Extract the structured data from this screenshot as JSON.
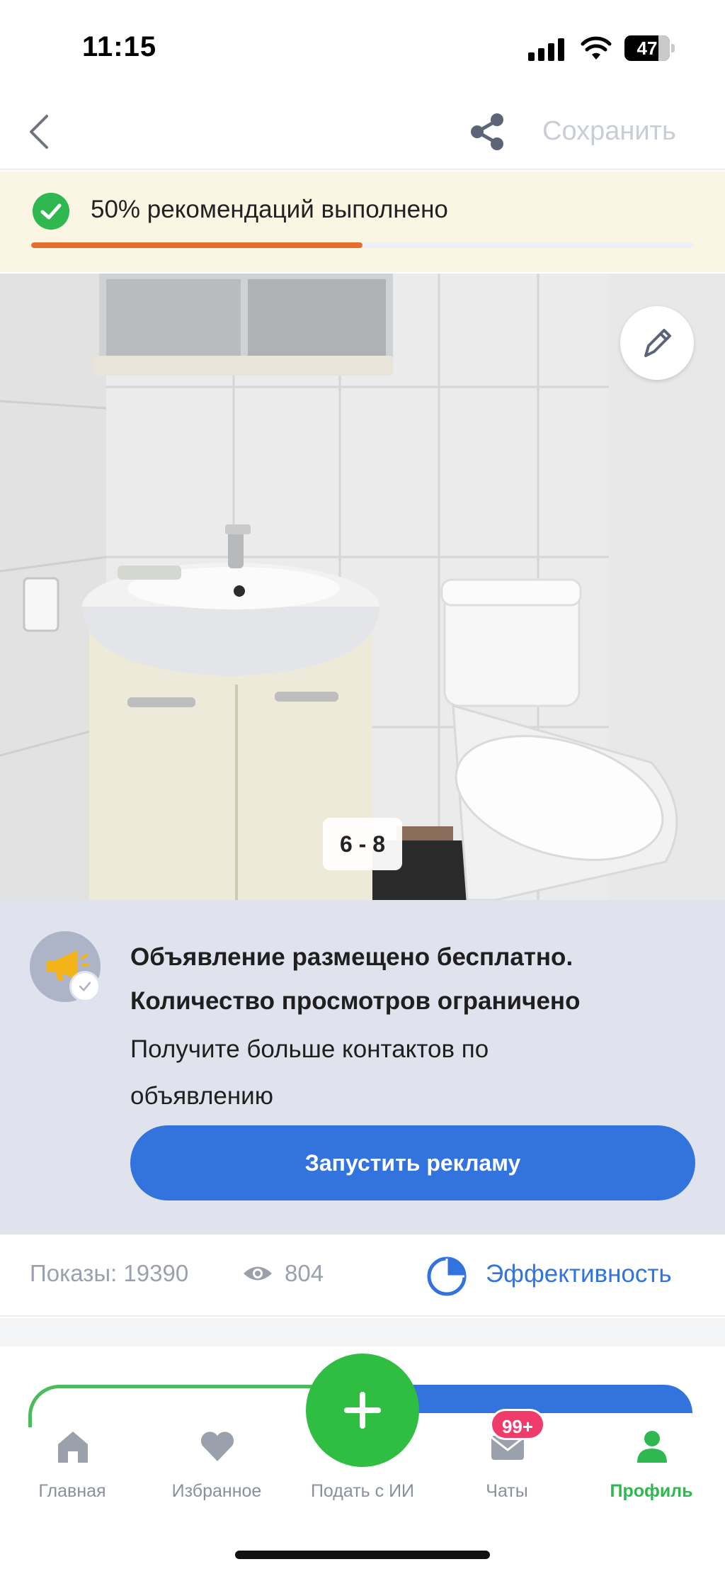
{
  "status_bar": {
    "time": "11:15",
    "battery": "47"
  },
  "header": {
    "save_label": "Сохранить"
  },
  "recommendations": {
    "text": "50% рекомендаций выполнено",
    "progress": 0.5,
    "progress_color": "#e46e2e",
    "check_color": "#2fb84f"
  },
  "photo": {
    "counter": "6 - 8"
  },
  "promo": {
    "title_line1": "Объявление размещено бесплатно.",
    "title_line2": "Количество просмотров ограничено",
    "subtitle_line1": "Получите больше контактов по",
    "subtitle_line2": "объявлению",
    "cta_label": "Запустить рекламу",
    "cta_color": "#3373dd"
  },
  "stats": {
    "impressions": "Показы: 19390",
    "views": "804",
    "performance_label": "Эффективность"
  },
  "tabbar": {
    "items": [
      {
        "label": "Главная",
        "icon": "home-icon"
      },
      {
        "label": "Избранное",
        "icon": "heart-icon"
      },
      {
        "label": "Подать с ИИ",
        "icon": "plus-icon"
      },
      {
        "label": "Чаты",
        "icon": "mail-icon",
        "badge": "99+"
      },
      {
        "label": "Профиль",
        "icon": "profile-icon",
        "active": true
      }
    ],
    "accent_color": "#2fb84f"
  }
}
